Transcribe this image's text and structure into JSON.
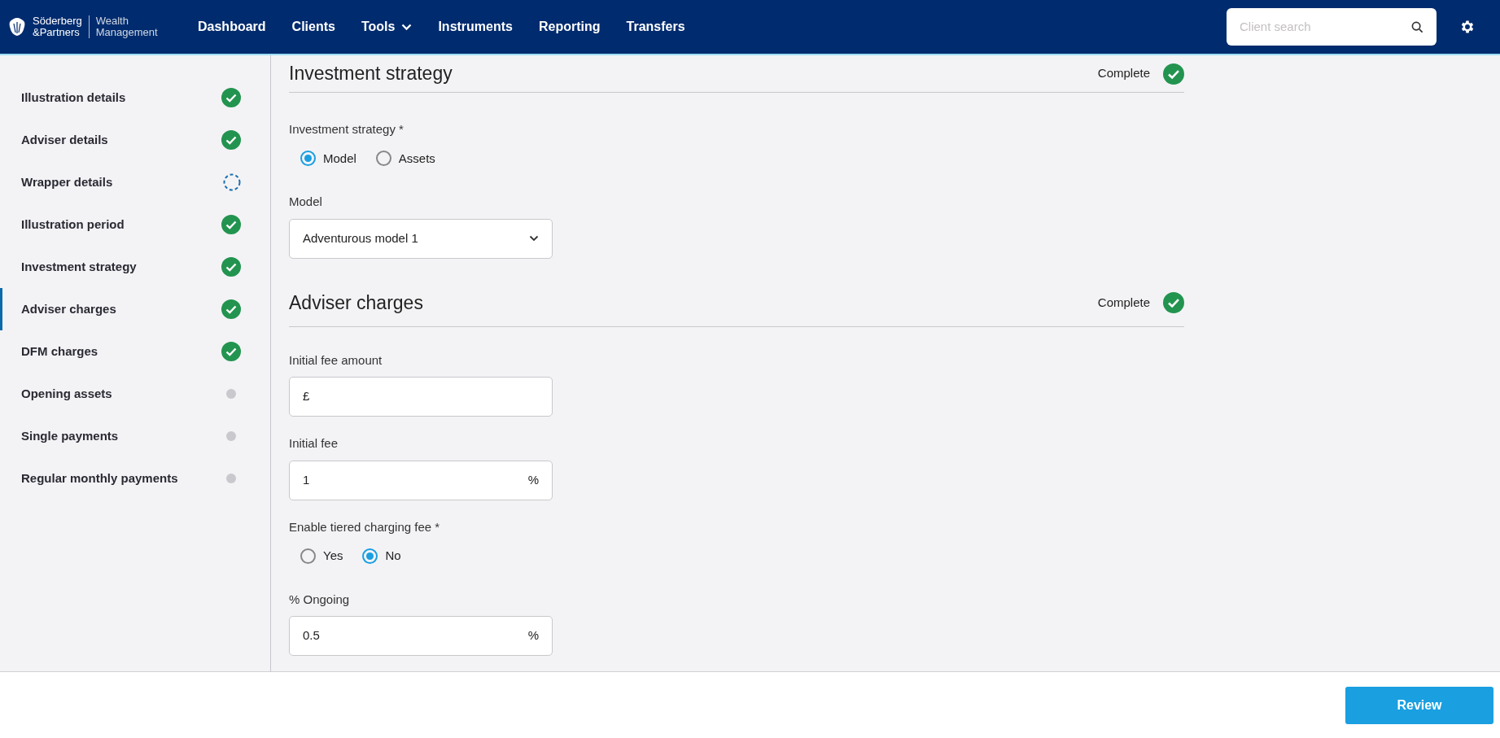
{
  "header": {
    "logo": {
      "brand_lines": [
        "Söderberg",
        "&Partners"
      ],
      "division_lines": [
        "Wealth",
        "Management"
      ]
    },
    "nav": [
      {
        "label": "Dashboard",
        "dropdown": false
      },
      {
        "label": "Clients",
        "dropdown": false
      },
      {
        "label": "Tools",
        "dropdown": true
      },
      {
        "label": "Instruments",
        "dropdown": false
      },
      {
        "label": "Reporting",
        "dropdown": false
      },
      {
        "label": "Transfers",
        "dropdown": false
      }
    ],
    "search": {
      "placeholder": "Client search"
    }
  },
  "sidebar": {
    "items": [
      {
        "label": "Illustration details",
        "kind": "complete",
        "selected": false
      },
      {
        "label": "Adviser details",
        "kind": "complete",
        "selected": false
      },
      {
        "label": "Wrapper details",
        "kind": "in_progress",
        "selected": false
      },
      {
        "label": "Illustration period",
        "kind": "complete",
        "selected": false
      },
      {
        "label": "Investment strategy",
        "kind": "complete",
        "selected": false
      },
      {
        "label": "Adviser charges",
        "kind": "complete",
        "selected": true
      },
      {
        "label": "DFM charges",
        "kind": "complete",
        "selected": false
      },
      {
        "label": "Opening assets",
        "kind": "pending",
        "selected": false
      },
      {
        "label": "Single payments",
        "kind": "pending",
        "selected": false
      },
      {
        "label": "Regular monthly payments",
        "kind": "pending",
        "selected": false
      }
    ]
  },
  "sections": [
    {
      "title": "Investment strategy",
      "status_text": "Complete",
      "complete": true,
      "fields": [
        {
          "kind": "radio",
          "label": "Investment strategy *",
          "options": [
            {
              "label": "Model",
              "selected": true
            },
            {
              "label": "Assets",
              "selected": false
            }
          ]
        },
        {
          "kind": "select",
          "label": "Model",
          "value": "Adventurous model 1"
        }
      ]
    },
    {
      "title": "Adviser charges",
      "status_text": "Complete",
      "complete": true,
      "fields": [
        {
          "kind": "input",
          "label": "Initial fee amount",
          "prefix": "£"
        },
        {
          "kind": "input",
          "label": "Initial fee",
          "value": "1",
          "suffix": "%"
        },
        {
          "kind": "radio",
          "label": "Enable tiered charging fee *",
          "options": [
            {
              "label": "Yes",
              "selected": false
            },
            {
              "label": "No",
              "selected": true
            }
          ]
        },
        {
          "kind": "input",
          "label": "% Ongoing",
          "value": "0.5",
          "suffix": "%"
        }
      ]
    }
  ],
  "footer": {
    "button": "Review"
  }
}
